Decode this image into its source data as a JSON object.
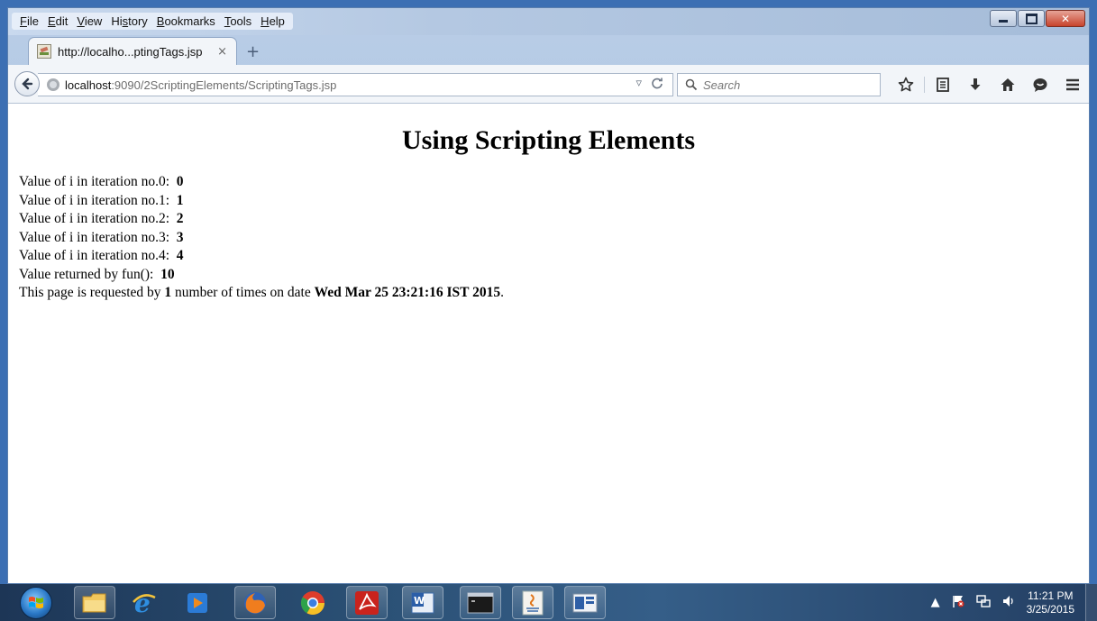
{
  "menu": [
    {
      "pre": "",
      "u": "F",
      "post": "ile"
    },
    {
      "pre": "",
      "u": "E",
      "post": "dit"
    },
    {
      "pre": "",
      "u": "V",
      "post": "iew"
    },
    {
      "pre": "Hi",
      "u": "s",
      "post": "tory"
    },
    {
      "pre": "",
      "u": "B",
      "post": "ookmarks"
    },
    {
      "pre": "",
      "u": "T",
      "post": "ools"
    },
    {
      "pre": "",
      "u": "H",
      "post": "elp"
    }
  ],
  "tab": {
    "title": "http://localho...ptingTags.jsp",
    "close": "×",
    "new_tab": "+"
  },
  "navbar": {
    "url_host": "localhost",
    "url_path": ":9090/2ScriptingElements/ScriptingTags.jsp",
    "search_placeholder": "Search"
  },
  "page": {
    "heading": "Using Scripting Elements",
    "iterations": [
      {
        "label": "Value of i in iteration no.0:",
        "value": "0"
      },
      {
        "label": "Value of i in iteration no.1:",
        "value": "1"
      },
      {
        "label": "Value of i in iteration no.2:",
        "value": "2"
      },
      {
        "label": "Value of i in iteration no.3:",
        "value": "3"
      },
      {
        "label": "Value of i in iteration no.4:",
        "value": "4"
      }
    ],
    "fun_label": "Value returned by fun():",
    "fun_value": "10",
    "request_prefix": "This page is requested by",
    "request_count": "1",
    "request_middle": "number of times on date",
    "request_date": "Wed Mar 25 23:21:16 IST 2015",
    "request_suffix": "."
  },
  "taskbar": {
    "apps": [
      "explorer-icon",
      "internet-explorer-icon",
      "media-player-icon",
      "firefox-icon",
      "chrome-icon",
      "acrobat-icon",
      "word-icon",
      "cmd-icon",
      "java-icon",
      "window-app-icon"
    ],
    "clock_time": "11:21 PM",
    "clock_date": "3/25/2015"
  },
  "colors": {
    "desktop": "#3c6fb3",
    "window_frame": "#b9cde6",
    "close_button": "#c7432c",
    "taskbar": "#2b5176"
  }
}
